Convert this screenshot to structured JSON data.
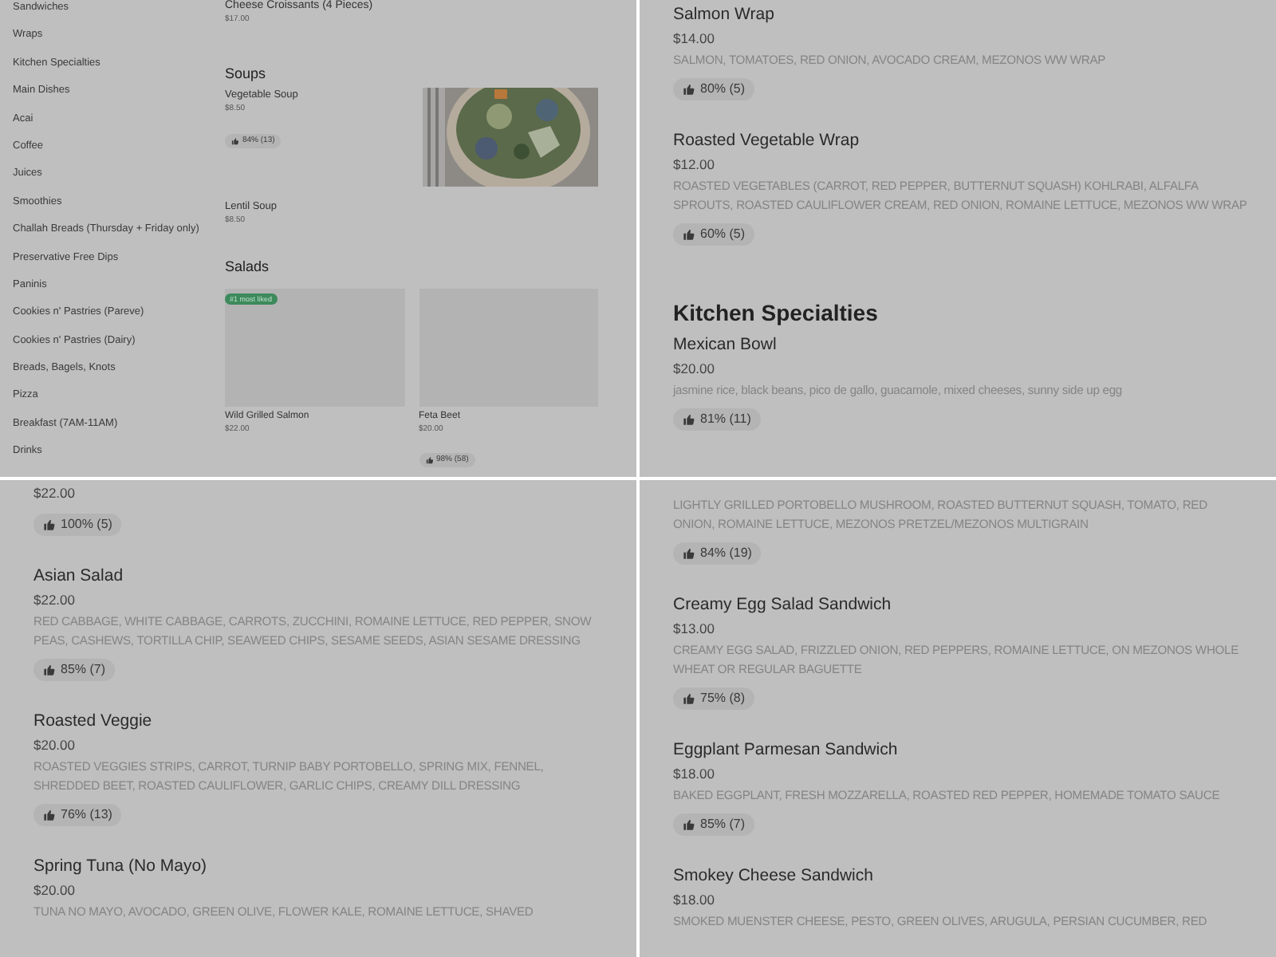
{
  "panels": [
    {
      "kind": "overview",
      "sidebar": [
        "Sandwiches",
        "Wraps",
        "Kitchen Specialties",
        "Main Dishes",
        "Acai",
        "Coffee",
        "Juices",
        "Smoothies",
        "Challah Breads (Thursday + Friday only)",
        "Preservative Free Dips",
        "Paninis",
        "Cookies n' Pastries (Pareve)",
        "Cookies n' Pastries (Dairy)",
        "Breads, Bagels, Knots",
        "Pizza",
        "Breakfast (7AM-11AM)",
        "Drinks"
      ],
      "top_item": {
        "name": "Cheese Croissants (4 Pieces)",
        "price": "$17.00"
      },
      "soups": {
        "title": "Soups",
        "items": [
          {
            "name": "Vegetable Soup",
            "price": "$8.50",
            "rating": "84% (13)",
            "picture": true
          },
          {
            "name": "Lentil Soup",
            "price": "$8.50",
            "picture": false
          }
        ]
      },
      "salads": {
        "title": "Salads",
        "cards": [
          {
            "name": "Wild Grilled Salmon",
            "price": "$22.00",
            "badge": "#1 most liked"
          },
          {
            "name": "Feta Beet",
            "price": "$20.00",
            "rating": "98% (58)"
          }
        ]
      }
    },
    {
      "kind": "list",
      "blocks": [
        {
          "kind": "item",
          "name": "Salmon Wrap",
          "price": "$14.00",
          "description": "SALMON, TOMATOES, RED ONION, AVOCADO CREAM, MEZONOS WW WRAP",
          "rating": "80% (5)"
        },
        {
          "kind": "item",
          "name": "Roasted Vegetable Wrap",
          "price": "$12.00",
          "description": "ROASTED VEGETABLES (CARROT, RED PEPPER, BUTTERNUT SQUASH) KOHLRABI, ALFALFA SPROUTS, ROASTED CAULIFLOWER CREAM, RED ONION, ROMAINE LETTUCE, MEZONOS WW WRAP",
          "rating": "60% (5)"
        },
        {
          "kind": "heading",
          "text": "Kitchen Specialties"
        },
        {
          "kind": "item",
          "name": "Mexican Bowl",
          "price": "$20.00",
          "description": "jasmine rice, black beans, pico de gallo, guacamole, mixed cheeses, sunny side up egg",
          "rating": "81% (11)"
        }
      ]
    },
    {
      "kind": "list",
      "blocks": [
        {
          "kind": "item",
          "price": "$22.00",
          "rating": "100% (5)"
        },
        {
          "kind": "item",
          "name": "Asian Salad",
          "price": "$22.00",
          "description": "RED CABBAGE, WHITE CABBAGE, CARROTS, ZUCCHINI, ROMAINE LETTUCE, RED PEPPER, SNOW PEAS, CASHEWS, TORTILLA CHIP, SEAWEED CHIPS, SESAME SEEDS, ASIAN SESAME DRESSING",
          "rating": "85% (7)"
        },
        {
          "kind": "item",
          "name": "Roasted Veggie",
          "price": "$20.00",
          "description": "ROASTED VEGGIES STRIPS, CARROT, TURNIP BABY PORTOBELLO, SPRING MIX, FENNEL, SHREDDED BEET, ROASTED CAULIFLOWER, GARLIC CHIPS, CREAMY DILL DRESSING",
          "rating": "76% (13)"
        },
        {
          "kind": "item",
          "name": "Spring Tuna (No Mayo)",
          "price": "$20.00",
          "description": "TUNA NO MAYO, AVOCADO, GREEN OLIVE, FLOWER KALE, ROMAINE LETTUCE, SHAVED"
        }
      ]
    },
    {
      "kind": "list",
      "blocks": [
        {
          "kind": "item",
          "description": "LIGHTLY GRILLED PORTOBELLO MUSHROOM, ROASTED BUTTERNUT SQUASH, TOMATO, RED ONION, ROMAINE LETTUCE, MEZONOS PRETZEL/MEZONOS MULTIGRAIN",
          "rating": "84% (19)"
        },
        {
          "kind": "item",
          "name": "Creamy Egg Salad Sandwich",
          "price": "$13.00",
          "description": "CREAMY EGG SALAD, FRIZZLED ONION, RED PEPPERS, ROMAINE LETTUCE, ON MEZONOS WHOLE WHEAT OR REGULAR BAGUETTE",
          "rating": "75% (8)"
        },
        {
          "kind": "item",
          "name": "Eggplant Parmesan Sandwich",
          "price": "$18.00",
          "description": "BAKED EGGPLANT, FRESH MOZZARELLA, ROASTED RED PEPPER, HOMEMADE TOMATO SAUCE",
          "rating": "85% (7)"
        },
        {
          "kind": "item",
          "name": "Smokey Cheese Sandwich",
          "price": "$18.00",
          "description": "SMOKED MUENSTER CHEESE, PESTO, GREEN OLIVES, ARUGULA, PERSIAN CUCUMBER, RED"
        }
      ]
    }
  ]
}
